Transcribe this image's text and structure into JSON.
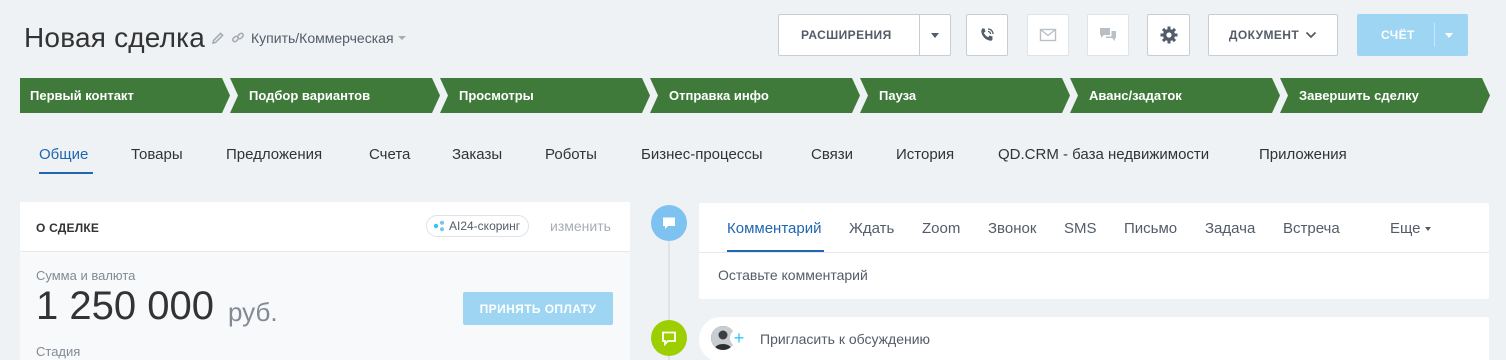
{
  "header": {
    "title": "Новая  сделка",
    "category": "Купить/Коммерческая"
  },
  "toolbar": {
    "extensions_label": "РАСШИРЕНИЯ",
    "document_label": "ДОКУМЕНТ",
    "invoice_label": "СЧЁТ"
  },
  "colors": {
    "stage_green": "#3f7a3a",
    "accent_blue": "#2067b0",
    "timeline_blue": "#7ec2f2",
    "timeline_green": "#9dcf00",
    "pay_button": "#9ed5f3",
    "invoice_button": "#9ed5f3"
  },
  "stages": [
    {
      "label": "Первый контакт"
    },
    {
      "label": "Подбор вариантов"
    },
    {
      "label": "Просмотры"
    },
    {
      "label": "Отправка инфо"
    },
    {
      "label": "Пауза"
    },
    {
      "label": "Аванс/задаток"
    },
    {
      "label": "Завершить сделку"
    }
  ],
  "tabs": [
    {
      "label": "Общие",
      "active": true
    },
    {
      "label": "Товары"
    },
    {
      "label": "Предложения"
    },
    {
      "label": "Счета"
    },
    {
      "label": "Заказы"
    },
    {
      "label": "Роботы"
    },
    {
      "label": "Бизнес-процессы"
    },
    {
      "label": "Связи"
    },
    {
      "label": "История"
    },
    {
      "label": "QD.CRM - база недвижимости"
    },
    {
      "label": "Приложения"
    }
  ],
  "deal_card": {
    "title": "О СДЕЛКЕ",
    "ai_badge": "AI24-скоринг",
    "change_link": "изменить",
    "sum_label": "Сумма и валюта",
    "sum_value": "1 250 000",
    "currency": "руб.",
    "pay_button": "ПРИНЯТЬ ОПЛАТУ",
    "stage_label": "Стадия"
  },
  "activity": {
    "tabs": [
      {
        "label": "Комментарий",
        "active": true
      },
      {
        "label": "Ждать"
      },
      {
        "label": "Zoom"
      },
      {
        "label": "Звонок"
      },
      {
        "label": "SMS"
      },
      {
        "label": "Письмо"
      },
      {
        "label": "Задача"
      },
      {
        "label": "Встреча"
      },
      {
        "label": "Еще"
      }
    ],
    "comment_placeholder": "Оставьте комментарий",
    "invite_label": "Пригласить к обсуждению"
  },
  "icons": {
    "edit": "pencil-icon",
    "link": "link-icon",
    "phone": "phone-icon",
    "mail": "mail-icon",
    "chat": "chat-icon",
    "settings": "gear-icon"
  }
}
